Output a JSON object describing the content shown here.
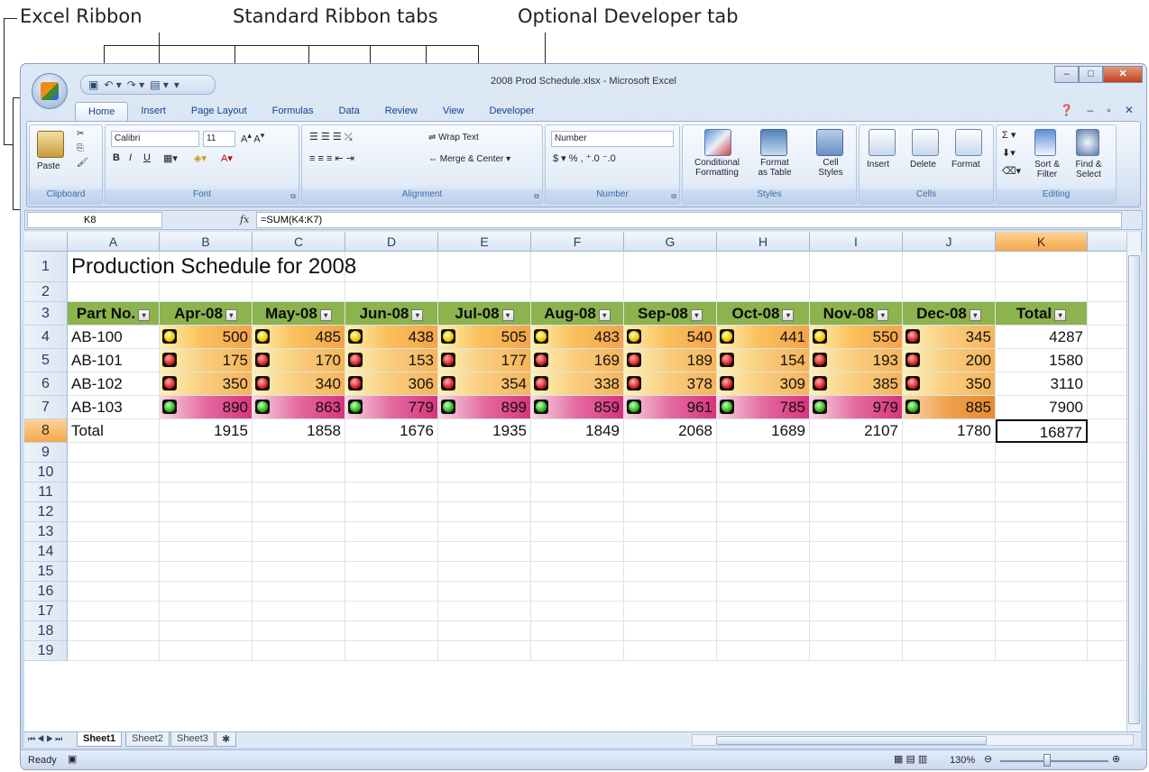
{
  "callouts": {
    "excel_ribbon": "Excel Ribbon",
    "standard_tabs": "Standard Ribbon tabs",
    "developer_tab": "Optional Developer tab"
  },
  "window": {
    "title": "2008 Prod Schedule.xlsx - Microsoft Excel"
  },
  "tabs": [
    "Home",
    "Insert",
    "Page Layout",
    "Formulas",
    "Data",
    "Review",
    "View",
    "Developer"
  ],
  "ribbon": {
    "clipboard": {
      "label": "Clipboard",
      "paste": "Paste"
    },
    "font": {
      "label": "Font",
      "name": "Calibri",
      "size": "11"
    },
    "alignment": {
      "label": "Alignment",
      "wrap": "Wrap Text",
      "merge": "Merge & Center"
    },
    "number": {
      "label": "Number",
      "format": "Number"
    },
    "styles": {
      "label": "Styles",
      "cond1": "Conditional",
      "cond2": "Formatting",
      "fmt1": "Format",
      "fmt2": "as Table",
      "cell1": "Cell",
      "cell2": "Styles"
    },
    "cells": {
      "label": "Cells",
      "insert": "Insert",
      "delete": "Delete",
      "format": "Format"
    },
    "editing": {
      "label": "Editing",
      "sort1": "Sort &",
      "sort2": "Filter",
      "find1": "Find &",
      "find2": "Select"
    }
  },
  "formula_bar": {
    "name_box": "K8",
    "fx": "fx",
    "formula": "=SUM(K4:K7)"
  },
  "columns": [
    "A",
    "B",
    "C",
    "D",
    "E",
    "F",
    "G",
    "H",
    "I",
    "J",
    "K"
  ],
  "rows": [
    "1",
    "2",
    "3",
    "4",
    "5",
    "6",
    "7",
    "8",
    "9",
    "10",
    "11",
    "12",
    "13",
    "14",
    "15",
    "16",
    "17",
    "18",
    "19"
  ],
  "sheet": {
    "title": "Production Schedule for 2008",
    "headers": [
      "Part No.",
      "Apr-08",
      "May-08",
      "Jun-08",
      "Jul-08",
      "Aug-08",
      "Sep-08",
      "Oct-08",
      "Nov-08",
      "Dec-08",
      "Total"
    ],
    "data": [
      {
        "part": "AB-100",
        "values": [
          "500",
          "485",
          "438",
          "505",
          "483",
          "540",
          "441",
          "550",
          "345"
        ],
        "total": "4287",
        "lights": [
          "yellow",
          "yellow",
          "yellow",
          "yellow",
          "yellow",
          "yellow",
          "yellow",
          "yellow",
          "red"
        ]
      },
      {
        "part": "AB-101",
        "values": [
          "175",
          "170",
          "153",
          "177",
          "169",
          "189",
          "154",
          "193",
          "200"
        ],
        "total": "1580",
        "lights": [
          "red",
          "red",
          "red",
          "red",
          "red",
          "red",
          "red",
          "red",
          "red"
        ]
      },
      {
        "part": "AB-102",
        "values": [
          "350",
          "340",
          "306",
          "354",
          "338",
          "378",
          "309",
          "385",
          "350"
        ],
        "total": "3110",
        "lights": [
          "red",
          "red",
          "red",
          "red",
          "red",
          "red",
          "red",
          "red",
          "red"
        ]
      },
      {
        "part": "AB-103",
        "values": [
          "890",
          "863",
          "779",
          "899",
          "859",
          "961",
          "785",
          "979",
          "885"
        ],
        "total": "7900",
        "lights": [
          "green",
          "green",
          "green",
          "green",
          "green",
          "green",
          "green",
          "green",
          "green"
        ]
      }
    ],
    "total_row": {
      "label": "Total",
      "values": [
        "1915",
        "1858",
        "1676",
        "1935",
        "1849",
        "2068",
        "1689",
        "2107",
        "1780"
      ],
      "total": "16877"
    }
  },
  "sheet_tabs": [
    "Sheet1",
    "Sheet2",
    "Sheet3"
  ],
  "status": {
    "ready": "Ready",
    "zoom": "130%"
  }
}
